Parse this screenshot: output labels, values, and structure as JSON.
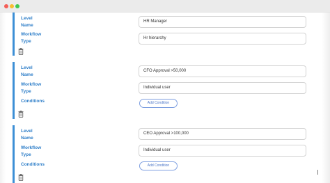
{
  "workflow_levels": [
    {
      "level_name_label": "Level\nName",
      "level_name_value": "HR Manager",
      "workflow_type_label": "Workflow\nType",
      "workflow_type_value": "Hr hierarchy"
    },
    {
      "level_name_label": "Level\nName",
      "level_name_value": "CFO Approval >50,000",
      "workflow_type_label": "Workflow\nType",
      "workflow_type_value": "Individual user",
      "conditions_label": "Conditions",
      "add_condition_label": "Add Condition"
    },
    {
      "level_name_label": "Level\nName",
      "level_name_value": "CEO Approval >100,000",
      "workflow_type_label": "Workflow\nType",
      "workflow_type_value": "Individual user",
      "conditions_label": "Conditions",
      "add_condition_label": "Add Condition"
    }
  ],
  "icons": {
    "delete": "trash-icon"
  },
  "colors": {
    "accent": "#3d8fd6",
    "label": "#2f7fc9",
    "button_border": "#7d9ee0"
  }
}
